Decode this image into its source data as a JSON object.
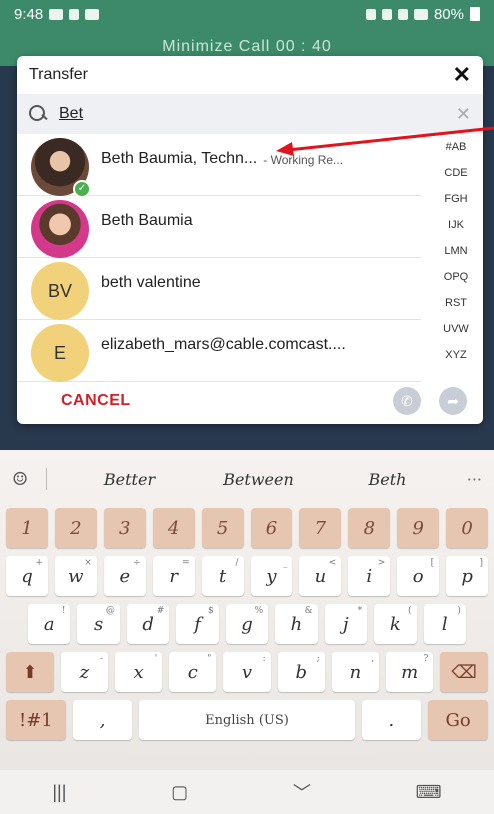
{
  "statusbar": {
    "time": "9:48",
    "battery": "80%"
  },
  "call": {
    "minimize_label": "Minimize Call",
    "timer": "00 : 40"
  },
  "dialog": {
    "title": "Transfer",
    "search_value": "Bet",
    "contacts": [
      {
        "name": "Beth Baumia, Techn...",
        "status": "- Working Re...",
        "avatar": "photo",
        "online": true
      },
      {
        "name": "Beth Baumia",
        "status": "",
        "avatar": "photo",
        "online": false
      },
      {
        "name": "beth valentine",
        "status": "",
        "initials": "BV"
      },
      {
        "name": "elizabeth_mars@cable.comcast....",
        "status": "",
        "initials": "E"
      }
    ],
    "alpha_index": [
      "#AB",
      "CDE",
      "FGH",
      "IJK",
      "LMN",
      "OPQ",
      "RST",
      "UVW",
      "XYZ"
    ],
    "cancel_label": "CANCEL"
  },
  "keyboard": {
    "suggestions": [
      "Better",
      "Between",
      "Beth"
    ],
    "numbers": [
      "1",
      "2",
      "3",
      "4",
      "5",
      "6",
      "7",
      "8",
      "9",
      "0"
    ],
    "row1": [
      [
        "q",
        "+"
      ],
      [
        "w",
        "×"
      ],
      [
        "e",
        "÷"
      ],
      [
        "r",
        "="
      ],
      [
        "t",
        "/"
      ],
      [
        "y",
        "_"
      ],
      [
        "u",
        "<"
      ],
      [
        "i",
        ">"
      ],
      [
        "o",
        "["
      ],
      [
        "p",
        "]"
      ]
    ],
    "row2": [
      [
        "a",
        "!"
      ],
      [
        "s",
        "@"
      ],
      [
        "d",
        "#"
      ],
      [
        "f",
        "$"
      ],
      [
        "g",
        "%"
      ],
      [
        "h",
        "&"
      ],
      [
        "j",
        "*"
      ],
      [
        "k",
        "("
      ],
      [
        "l",
        ")"
      ]
    ],
    "row3": [
      [
        "z",
        "-"
      ],
      [
        "x",
        "'"
      ],
      [
        "c",
        "\""
      ],
      [
        "v",
        ":"
      ],
      [
        "b",
        ";"
      ],
      [
        "n",
        ","
      ],
      [
        "m",
        "?"
      ]
    ],
    "sym_label": "!#1",
    "comma": ",",
    "space_label": "English (US)",
    "period": ".",
    "go_label": "Go"
  },
  "colors": {
    "accent_green": "#3d8a6a",
    "cancel_red": "#d0202a",
    "annotation_red": "#e0141e"
  }
}
